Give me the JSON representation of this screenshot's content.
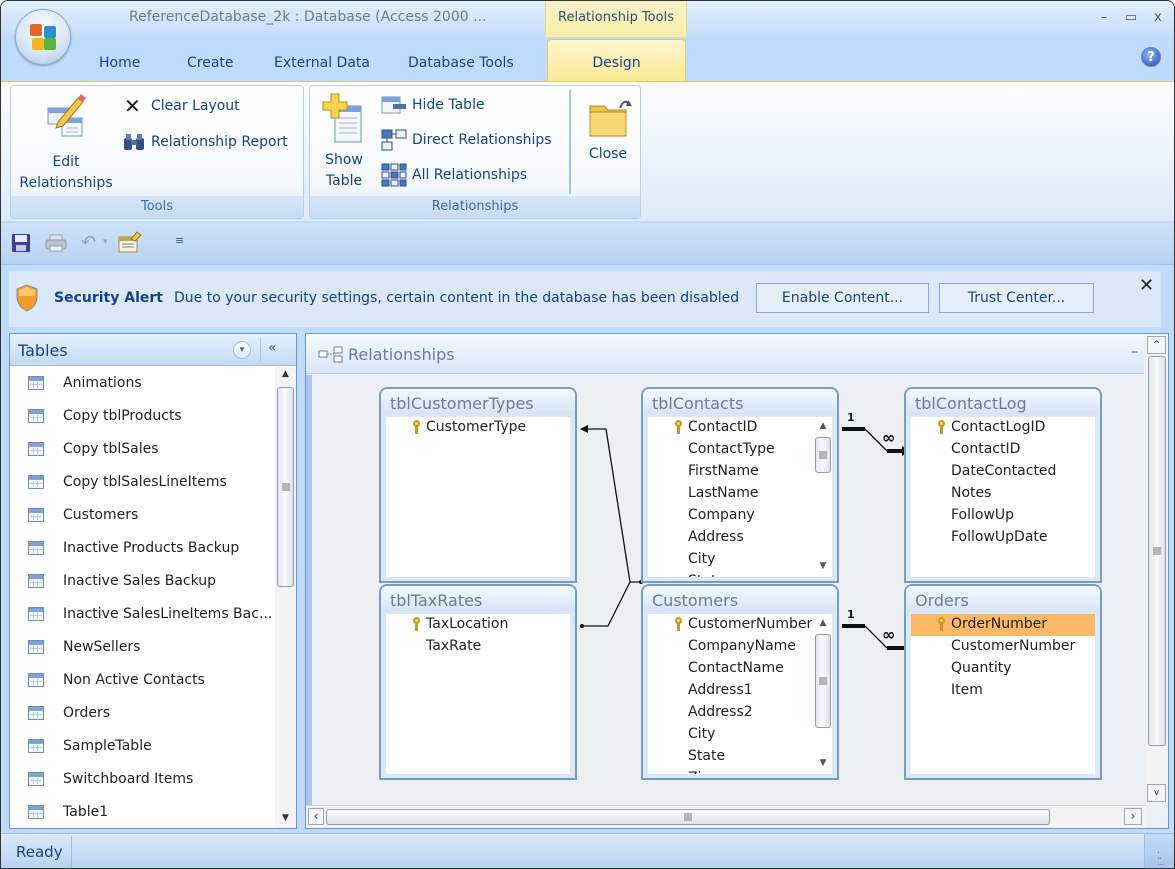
{
  "window": {
    "title": "ReferenceDatabase_2k : Database (Access 2000 ...",
    "contextual_tab_group": "Relationship Tools",
    "controls": {
      "minimize": "–",
      "maximize": "▭",
      "close": "x"
    }
  },
  "ribbon": {
    "tabs": [
      {
        "label": "Home"
      },
      {
        "label": "Create"
      },
      {
        "label": "External Data"
      },
      {
        "label": "Database Tools"
      },
      {
        "label": "Design",
        "active": true
      }
    ],
    "help_label": "?",
    "groups": [
      {
        "label": "Tools",
        "buttons": [
          {
            "label_line1": "Edit",
            "label_line2": "Relationships",
            "icon": "edit-relationships-icon"
          },
          {
            "label": "Clear Layout",
            "icon": "clear-layout-icon"
          },
          {
            "label": "Relationship Report",
            "icon": "relationship-report-icon"
          }
        ]
      },
      {
        "label": "Relationships",
        "buttons": [
          {
            "label_line1": "Show",
            "label_line2": "Table",
            "icon": "show-table-icon"
          },
          {
            "label": "Hide Table",
            "icon": "hide-table-icon"
          },
          {
            "label": "Direct Relationships",
            "icon": "direct-relationships-icon"
          },
          {
            "label": "All Relationships",
            "icon": "all-relationships-icon"
          },
          {
            "label": "Close",
            "icon": "close-folder-icon"
          }
        ]
      }
    ]
  },
  "quick_access": {
    "items": [
      "save-icon",
      "print-icon",
      "undo-icon",
      "undo-dropdown-icon",
      "properties-icon",
      "customize-qat-icon"
    ]
  },
  "security_bar": {
    "title": "Security Alert",
    "message": "Due to your security settings, certain content in the database has been disabled",
    "enable_button": "Enable Content...",
    "trust_button": "Trust Center...",
    "close": "✕"
  },
  "nav_pane": {
    "title": "Tables",
    "dropdown": "▾",
    "collapse": "«",
    "items": [
      "Animations",
      "Copy tblProducts",
      "Copy tblSales",
      "Copy tblSalesLineItems",
      "Customers",
      "Inactive Products Backup",
      "Inactive Sales Backup",
      "Inactive SalesLineItems Bac...",
      "NewSellers",
      "Non Active Contacts",
      "Orders",
      "SampleTable",
      "Switchboard Items",
      "Table1"
    ]
  },
  "document": {
    "title": "Relationships",
    "minimize": "–",
    "tables": [
      {
        "name": "tblCustomerTypes",
        "key_field": "CustomerType",
        "fields": [
          "CustomerType"
        ],
        "has_scroll": false
      },
      {
        "name": "tblContacts",
        "key_field": "ContactID",
        "fields": [
          "ContactID",
          "ContactType",
          "FirstName",
          "LastName",
          "Company",
          "Address",
          "City",
          "State"
        ],
        "has_scroll": true
      },
      {
        "name": "tblContactLog",
        "key_field": "ContactLogID",
        "fields": [
          "ContactLogID",
          "ContactID",
          "DateContacted",
          "Notes",
          "FollowUp",
          "FollowUpDate"
        ],
        "has_scroll": false
      },
      {
        "name": "tblTaxRates",
        "key_field": "TaxLocation",
        "fields": [
          "TaxLocation",
          "TaxRate"
        ],
        "has_scroll": false
      },
      {
        "name": "Customers",
        "key_field": "CustomerNumber",
        "fields": [
          "CustomerNumber",
          "CompanyName",
          "ContactName",
          "Address1",
          "Address2",
          "City",
          "State",
          "Zip"
        ],
        "has_scroll": true
      },
      {
        "name": "Orders",
        "key_field": "OrderNumber",
        "fields": [
          "OrderNumber",
          "CustomerNumber",
          "Quantity",
          "Item"
        ],
        "has_scroll": false,
        "selected_field": "OrderNumber"
      }
    ],
    "relationships": [
      {
        "from": "tblContacts.ContactID",
        "to": "tblContactLog.ContactID",
        "one_label": "1",
        "many_label": "∞",
        "enforced": true
      },
      {
        "from": "Customers.CustomerNumber",
        "to": "Orders.CustomerNumber",
        "one_label": "1",
        "many_label": "∞",
        "enforced": true
      },
      {
        "from": "tblContacts",
        "to": "tblCustomerTypes.CustomerType",
        "enforced": false
      },
      {
        "from": "tblContacts",
        "to": "tblTaxRates.TaxLocation",
        "enforced": false
      }
    ]
  },
  "status_bar": {
    "text": "Ready"
  },
  "colors": {
    "ribbon_blue": "#bfdbff",
    "contextual_yellow": "#fbe993",
    "selected_field": "#fbb968",
    "text_blue": "#15428b"
  }
}
